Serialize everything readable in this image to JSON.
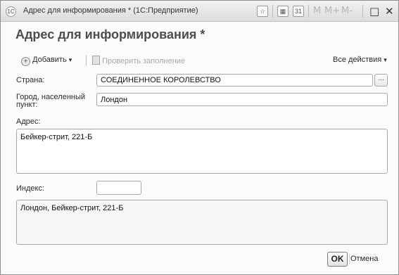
{
  "window": {
    "title": "Адрес для информирования * (1С:Предприятие)",
    "app_icon": "1С",
    "toolbar": {
      "m": "M",
      "mplus": "M+",
      "mminus": "M-"
    }
  },
  "form": {
    "title": "Адрес для информирования *"
  },
  "commands": {
    "add_label": "Добавить",
    "check_label": "Проверить заполнение",
    "all_actions_label": "Все действия"
  },
  "fields": {
    "country_label": "Страна:",
    "country_value": "СОЕДИНЕННОЕ КОРОЛЕВСТВО",
    "city_label": "Город, населенный пункт:",
    "city_value": "Лондон",
    "address_label": "Адрес:",
    "address_value": "Бейкер-стрит, 221-Б",
    "index_label": "Индекс:",
    "index_value": "",
    "presentation_value": "Лондон, Бейкер-стрит, 221-Б"
  },
  "footer": {
    "ok_label": "OK",
    "cancel_label": "Отмена"
  }
}
